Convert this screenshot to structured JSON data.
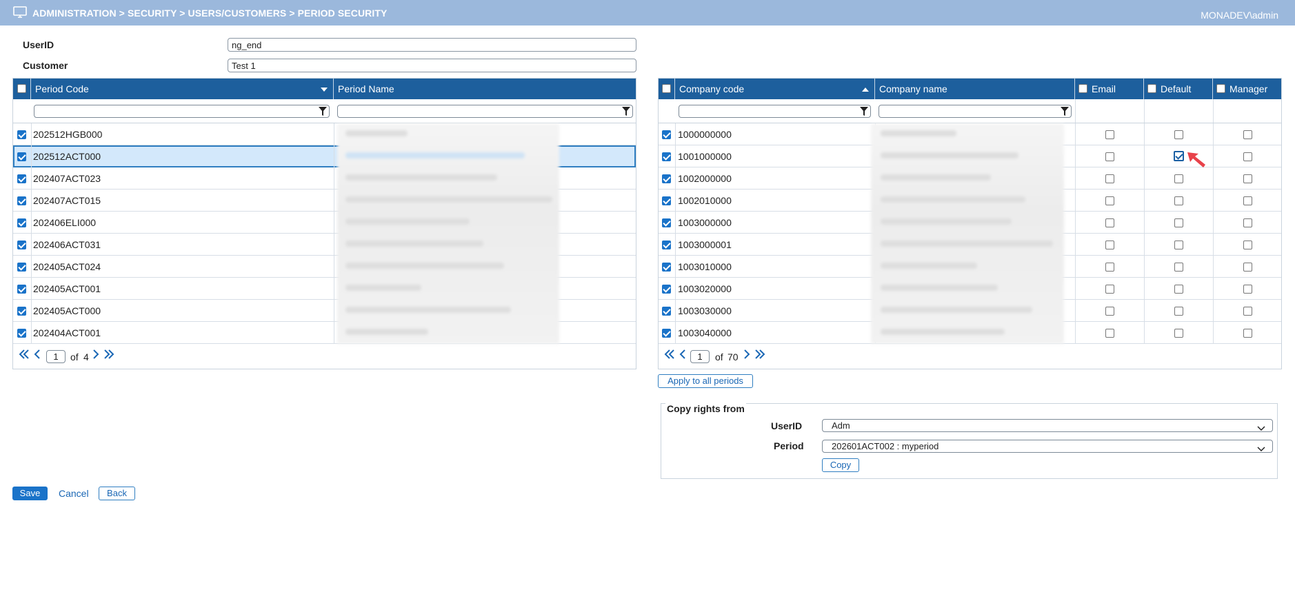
{
  "header": {
    "breadcrumb": "ADMINISTRATION > SECURITY > USERS/CUSTOMERS > PERIOD SECURITY",
    "user": "MONADEV\\admin"
  },
  "form": {
    "userid_label": "UserID",
    "userid_value": "ng_end",
    "customer_label": "Customer",
    "customer_value": "Test 1"
  },
  "period_grid": {
    "col_code": "Period Code",
    "col_name": "Period Name",
    "rows": [
      {
        "code": "202512HGB000",
        "checked": true
      },
      {
        "code": "202512ACT000",
        "checked": true,
        "selected": true
      },
      {
        "code": "202407ACT023",
        "checked": true
      },
      {
        "code": "202407ACT015",
        "checked": true
      },
      {
        "code": "202406ELI000",
        "checked": true
      },
      {
        "code": "202406ACT031",
        "checked": true
      },
      {
        "code": "202405ACT024",
        "checked": true
      },
      {
        "code": "202405ACT001",
        "checked": true
      },
      {
        "code": "202405ACT000",
        "checked": true
      },
      {
        "code": "202404ACT001",
        "checked": true
      }
    ],
    "page": "1",
    "of": "of",
    "total": "4"
  },
  "company_grid": {
    "col_code": "Company code",
    "col_name": "Company name",
    "col_email": "Email",
    "col_default": "Default",
    "col_manager": "Manager",
    "rows": [
      {
        "code": "1000000000",
        "email": false,
        "default": false,
        "manager": false
      },
      {
        "code": "1001000000",
        "email": false,
        "default": true,
        "manager": false
      },
      {
        "code": "1002000000",
        "email": false,
        "default": false,
        "manager": false
      },
      {
        "code": "1002010000",
        "email": false,
        "default": false,
        "manager": false
      },
      {
        "code": "1003000000",
        "email": false,
        "default": false,
        "manager": false
      },
      {
        "code": "1003000001",
        "email": false,
        "default": false,
        "manager": false
      },
      {
        "code": "1003010000",
        "email": false,
        "default": false,
        "manager": false
      },
      {
        "code": "1003020000",
        "email": false,
        "default": false,
        "manager": false
      },
      {
        "code": "1003030000",
        "email": false,
        "default": false,
        "manager": false
      },
      {
        "code": "1003040000",
        "email": false,
        "default": false,
        "manager": false
      }
    ],
    "page": "1",
    "of": "of",
    "total": "70"
  },
  "apply_button": "Apply to all periods",
  "copy_rights": {
    "legend": "Copy rights from",
    "userid_label": "UserID",
    "userid_value": "Adm",
    "period_label": "Period",
    "period_value": "202601ACT002 : myperiod",
    "copy_button": "Copy"
  },
  "actions": {
    "save": "Save",
    "cancel": "Cancel",
    "back": "Back"
  },
  "colors": {
    "header_bar": "#9bb8dc",
    "grid_header": "#1d5f9d",
    "accent": "#1a73c9",
    "selected_row": "#d3e8fb",
    "annotation_arrow": "#e8424a"
  }
}
